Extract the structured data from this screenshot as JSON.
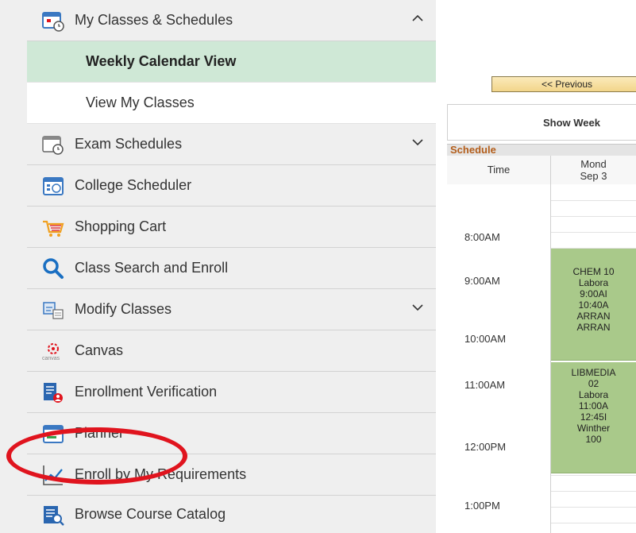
{
  "sidebar": {
    "classes_section": {
      "label": "My Classes & Schedules"
    },
    "sub_items": [
      {
        "label": "Weekly Calendar View",
        "active": true
      },
      {
        "label": "View My Classes",
        "active": false
      }
    ],
    "items": [
      {
        "label": "Exam Schedules",
        "icon": "exam-schedule-icon"
      },
      {
        "label": "College Scheduler",
        "icon": "college-scheduler-icon"
      },
      {
        "label": "Shopping Cart",
        "icon": "shopping-cart-icon"
      },
      {
        "label": "Class Search and Enroll",
        "icon": "search-icon"
      },
      {
        "label": "Modify Classes",
        "icon": "modify-classes-icon"
      },
      {
        "label": "Canvas",
        "icon": "canvas-icon",
        "icon_text": "canvas"
      },
      {
        "label": "Enrollment Verification",
        "icon": "enrollment-verification-icon"
      },
      {
        "label": "Planner",
        "icon": "planner-icon"
      },
      {
        "label": "Enroll by My Requirements",
        "icon": "chart-icon"
      },
      {
        "label": "Browse Course Catalog",
        "icon": "catalog-icon"
      }
    ]
  },
  "calendar": {
    "prev_label": "<< Previous",
    "show_week_label": "Show Week",
    "schedule_label": "Schedule",
    "time_header": "Time",
    "day_header_line1": "Mond",
    "day_header_line2": "Sep 3",
    "times": [
      "8:00AM",
      "9:00AM",
      "10:00AM",
      "11:00AM",
      "12:00PM",
      "1:00PM"
    ],
    "events": [
      {
        "lines": [
          "CHEM 10",
          "Labora",
          "9:00AI",
          "10:40A",
          "ARRAN",
          "ARRAN"
        ]
      },
      {
        "lines": [
          "LIBMEDIA",
          "02",
          "Labora",
          "11:00A",
          "12:45I",
          "Winther",
          "100"
        ]
      }
    ]
  },
  "colors": {
    "active_bg": "#cfe8d6",
    "event_bg": "#a9c98a",
    "highlight_oval": "#e0141e",
    "schedule_title": "#b35d1a"
  }
}
